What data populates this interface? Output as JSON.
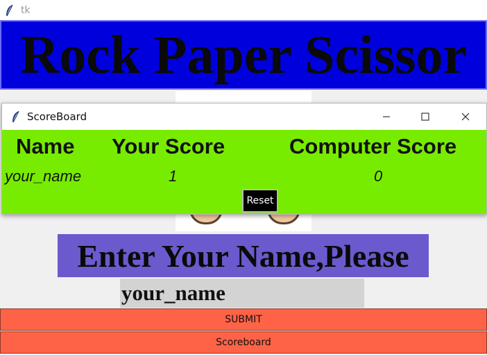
{
  "main_window": {
    "title": "tk"
  },
  "banner": {
    "text": "Rock Paper Scissor"
  },
  "scoreboard_window": {
    "title": "ScoreBoard",
    "headers": {
      "name": "Name",
      "your_score": "Your Score",
      "computer_score": "Computer Score"
    },
    "row": {
      "name": "your_name",
      "your_score": "1",
      "computer_score": "0"
    },
    "reset_label": "Reset"
  },
  "form": {
    "prompt": "Enter Your Name,Please",
    "name_value": "your_name",
    "submit_label": "SUBMIT",
    "scoreboard_label": "Scoreboard"
  },
  "colors": {
    "banner_bg": "#0000dd",
    "scoreboard_bg": "#78ec00",
    "prompt_bg": "#6a5acd",
    "button_bg": "#ff6347",
    "input_bg": "#d3d3d3"
  },
  "icons": {
    "app_icon": "feather-icon",
    "minimize": "minimize-icon",
    "maximize": "maximize-icon",
    "close": "close-icon"
  }
}
